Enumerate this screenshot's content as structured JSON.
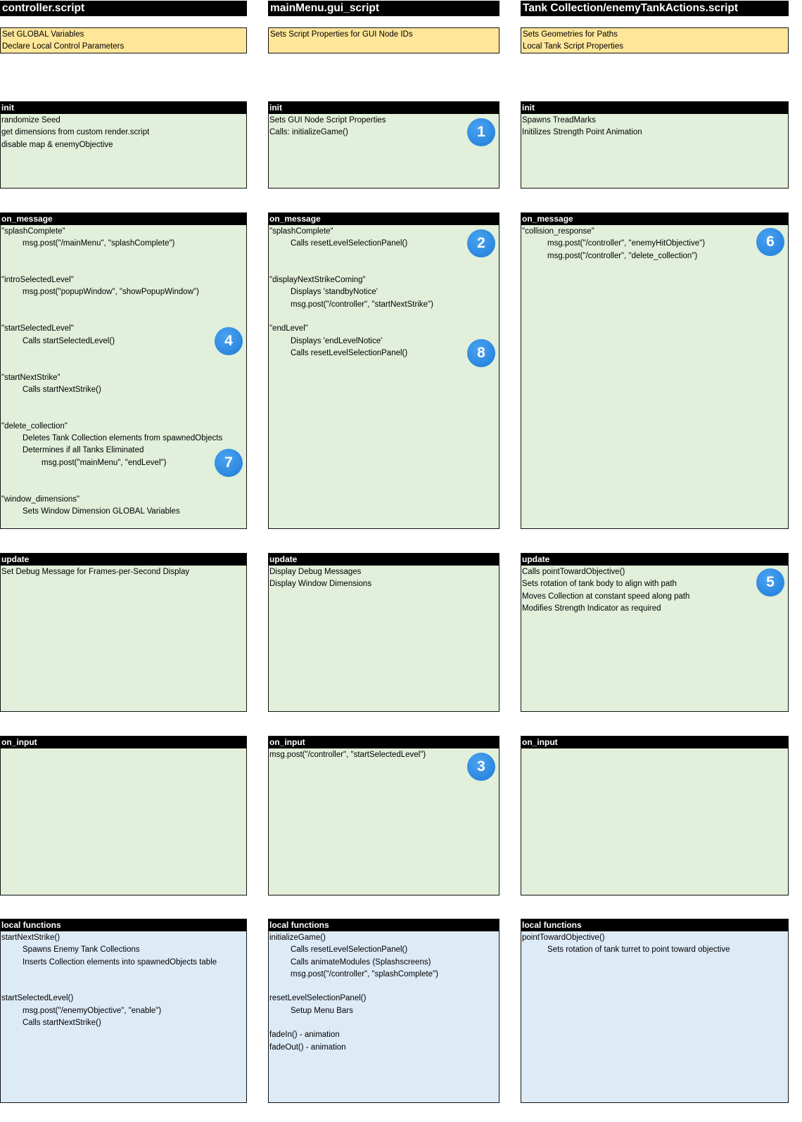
{
  "columns": [
    {
      "title": "controller.script",
      "summary": [
        "Set GLOBAL Variables",
        "Declare Local Control Parameters"
      ],
      "sections": {
        "init": {
          "header": "init",
          "lines": [
            {
              "text": "randomize Seed",
              "indent": 0
            },
            {
              "text": "get dimensions from custom render.script",
              "indent": 0
            },
            {
              "text": "disable map & enemyObjective",
              "indent": 0
            }
          ]
        },
        "on_message": {
          "header": "on_message",
          "lines": [
            {
              "text": "\"splashComplete\"",
              "indent": 0
            },
            {
              "text": "msg.post(\"/mainMenu\", \"splashComplete\")",
              "indent": 1
            },
            {
              "text": "",
              "indent": 0
            },
            {
              "text": "",
              "indent": 0
            },
            {
              "text": "\"introSelectedLevel\"",
              "indent": 0
            },
            {
              "text": "msg.post(\"popupWindow\", \"showPopupWindow\")",
              "indent": 1
            },
            {
              "text": "",
              "indent": 0
            },
            {
              "text": "",
              "indent": 0
            },
            {
              "text": "\"startSelectedLevel\"",
              "indent": 0
            },
            {
              "text": "Calls startSelectedLevel()",
              "indent": 1
            },
            {
              "text": "",
              "indent": 0
            },
            {
              "text": "",
              "indent": 0
            },
            {
              "text": "\"startNextStrike\"",
              "indent": 0
            },
            {
              "text": "Calls startNextStrike()",
              "indent": 1
            },
            {
              "text": "",
              "indent": 0
            },
            {
              "text": "",
              "indent": 0
            },
            {
              "text": "\"delete_collection\"",
              "indent": 0
            },
            {
              "text": "Deletes Tank Collection elements from spawnedObjects",
              "indent": 1
            },
            {
              "text": "Determines if all Tanks Eliminated",
              "indent": 1
            },
            {
              "text": "msg.post(\"mainMenu\", \"endLevel\")",
              "indent": 2
            },
            {
              "text": "",
              "indent": 0
            },
            {
              "text": "",
              "indent": 0
            },
            {
              "text": "\"window_dimensions\"",
              "indent": 0
            },
            {
              "text": "Sets Window Dimension GLOBAL Variables",
              "indent": 1
            }
          ],
          "badges": [
            {
              "number": "4",
              "line": 8.6
            },
            {
              "number": "7",
              "line": 18.6
            }
          ]
        },
        "update": {
          "header": "update",
          "lines": [
            {
              "text": "Set Debug Message for Frames-per-Second Display",
              "indent": 0
            }
          ]
        },
        "on_input": {
          "header": "on_input",
          "lines": []
        },
        "local_functions": {
          "header": "local functions",
          "lines": [
            {
              "text": "startNextStrike()",
              "indent": 0
            },
            {
              "text": "Spawns Enemy Tank Collections",
              "indent": 1
            },
            {
              "text": "Inserts Collection elements into spawnedObjects table",
              "indent": 1
            },
            {
              "text": "",
              "indent": 0
            },
            {
              "text": "",
              "indent": 0
            },
            {
              "text": "startSelectedLevel()",
              "indent": 0
            },
            {
              "text": "msg.post(\"/enemyObjective\", \"enable\")",
              "indent": 1
            },
            {
              "text": "Calls startNextStrike()",
              "indent": 1
            }
          ]
        }
      }
    },
    {
      "title": "mainMenu.gui_script",
      "summary": [
        "Sets Script Properties for GUI Node IDs"
      ],
      "sections": {
        "init": {
          "header": "init",
          "lines": [
            {
              "text": "Sets GUI Node Script Properties",
              "indent": 0
            },
            {
              "text": "Calls: initializeGame()",
              "indent": 0
            }
          ],
          "badges": [
            {
              "number": "1",
              "line": 0.6
            }
          ]
        },
        "on_message": {
          "header": "on_message",
          "lines": [
            {
              "text": "\"splashComplete\"",
              "indent": 0
            },
            {
              "text": "Calls resetLevelSelectionPanel()",
              "indent": 1
            },
            {
              "text": "",
              "indent": 0
            },
            {
              "text": "",
              "indent": 0
            },
            {
              "text": "\"displayNextStrikeComing\"",
              "indent": 0
            },
            {
              "text": "Displays 'standbyNotice'",
              "indent": 1
            },
            {
              "text": "msg.post(\"/controller\", \"startNextStrike\")",
              "indent": 1
            },
            {
              "text": "",
              "indent": 0
            },
            {
              "text": "\"endLevel\"",
              "indent": 0
            },
            {
              "text": "Displays 'endLevelNotice'",
              "indent": 1
            },
            {
              "text": "Calls resetLevelSelectionPanel()",
              "indent": 1
            }
          ],
          "badges": [
            {
              "number": "2",
              "line": 0.6
            },
            {
              "number": "8",
              "line": 9.6
            }
          ]
        },
        "update": {
          "header": "update",
          "lines": [
            {
              "text": "Display Debug Messages",
              "indent": 0
            },
            {
              "text": "Display Window Dimensions",
              "indent": 0
            }
          ]
        },
        "on_input": {
          "header": "on_input",
          "lines": [
            {
              "text": "msg.post(\"/controller\", \"startSelectedLevel\")",
              "indent": 0
            }
          ],
          "badges": [
            {
              "number": "3",
              "line": 0.6
            }
          ]
        },
        "local_functions": {
          "header": "local functions",
          "lines": [
            {
              "text": "initializeGame()",
              "indent": 0
            },
            {
              "text": "Calls resetLevelSelectionPanel()",
              "indent": 1
            },
            {
              "text": "Calls animateModules (Splashscreens)",
              "indent": 1
            },
            {
              "text": "msg.post(\"/controller\", \"splashComplete\")",
              "indent": 1
            },
            {
              "text": "",
              "indent": 0
            },
            {
              "text": "resetLevelSelectionPanel()",
              "indent": 0
            },
            {
              "text": "Setup Menu Bars",
              "indent": 1
            },
            {
              "text": "",
              "indent": 0
            },
            {
              "text": "fadeIn() - animation",
              "indent": 0
            },
            {
              "text": "fadeOut() - animation",
              "indent": 0
            }
          ]
        }
      }
    },
    {
      "title": "Tank Collection/enemyTankActions.script",
      "summary": [
        "Sets Geometries for Paths",
        "Local Tank Script Properties"
      ],
      "sections": {
        "init": {
          "header": "init",
          "lines": [
            {
              "text": "Spawns TreadMarks",
              "indent": 0
            },
            {
              "text": "Initilizes Strength Point Animation",
              "indent": 0
            }
          ]
        },
        "on_message": {
          "header": "on_message",
          "lines": [
            {
              "text": "\"collision_response\"",
              "indent": 0
            },
            {
              "text": "msg.post(\"/controller\", \"enemyHitObjective\")",
              "indent": 3
            },
            {
              "text": "msg.post(\"/controller\", \"delete_collection\")",
              "indent": 3
            }
          ],
          "badges": [
            {
              "number": "6",
              "line": 0.45
            }
          ]
        },
        "update": {
          "header": "update",
          "lines": [
            {
              "text": "Calls pointTowardObjective()",
              "indent": 0
            },
            {
              "text": "Sets rotation of tank body to align with path",
              "indent": 0
            },
            {
              "text": "Moves Collection at constant speed along path",
              "indent": 0
            },
            {
              "text": "Modifies Strength Indicator as required",
              "indent": 0
            }
          ],
          "badges": [
            {
              "number": "5",
              "line": 0.45
            }
          ]
        },
        "on_input": {
          "header": "on_input",
          "lines": []
        },
        "local_functions": {
          "header": "local functions",
          "lines": [
            {
              "text": "pointTowardObjective()",
              "indent": 0
            },
            {
              "text": "Sets rotation of tank turret to point toward objective",
              "indent": 3
            }
          ]
        }
      }
    }
  ],
  "colors": {
    "header_bg": "#000000",
    "summary_bg": "#ffe699",
    "handler_bg": "#e2efda",
    "local_functions_bg": "#ddebf7",
    "badge": "#2f8fe6"
  }
}
